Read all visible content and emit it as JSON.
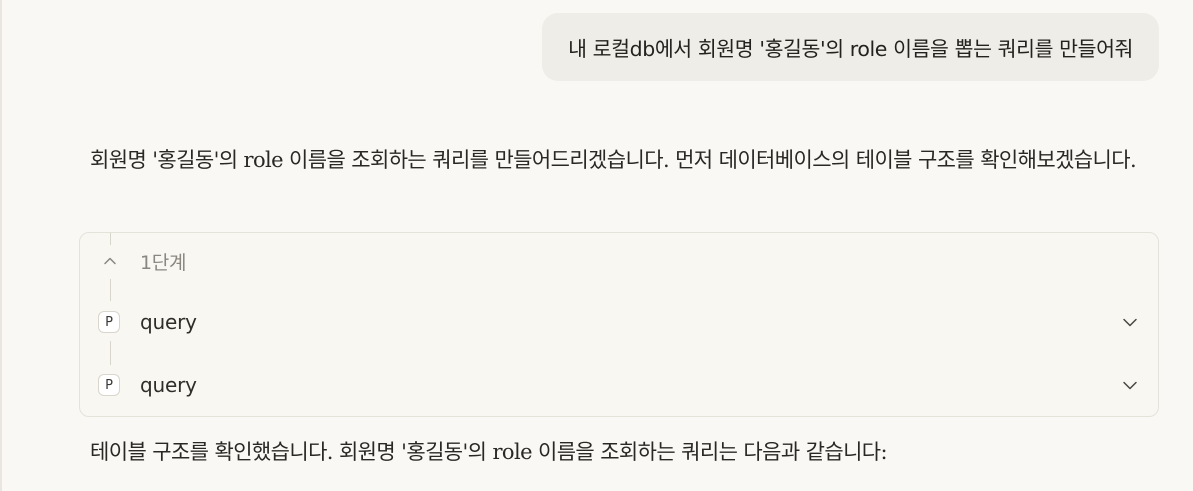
{
  "conversation": {
    "user_message": "내 로컬db에서 회원명 '홍길동'의 role 이름을 뽑는 쿼리를 만들어줘",
    "assistant_intro": "회원명 '홍길동'의 role 이름을 조회하는 쿼리를 만들어드리겠습니다. 먼저 데이터베이스의 테이블 구조를 확인해보겠습니다.",
    "assistant_followup": "테이블 구조를 확인했습니다. 회원명 '홍길동'의 role 이름을 조회하는 쿼리는 다음과 같습니다:"
  },
  "steps_panel": {
    "step_label": "1단계",
    "collapse_icon": "chevron-up-icon",
    "tool_calls": [
      {
        "badge": "P",
        "name": "query",
        "expand_icon": "chevron-down-icon"
      },
      {
        "badge": "P",
        "name": "query",
        "expand_icon": "chevron-down-icon"
      }
    ]
  }
}
